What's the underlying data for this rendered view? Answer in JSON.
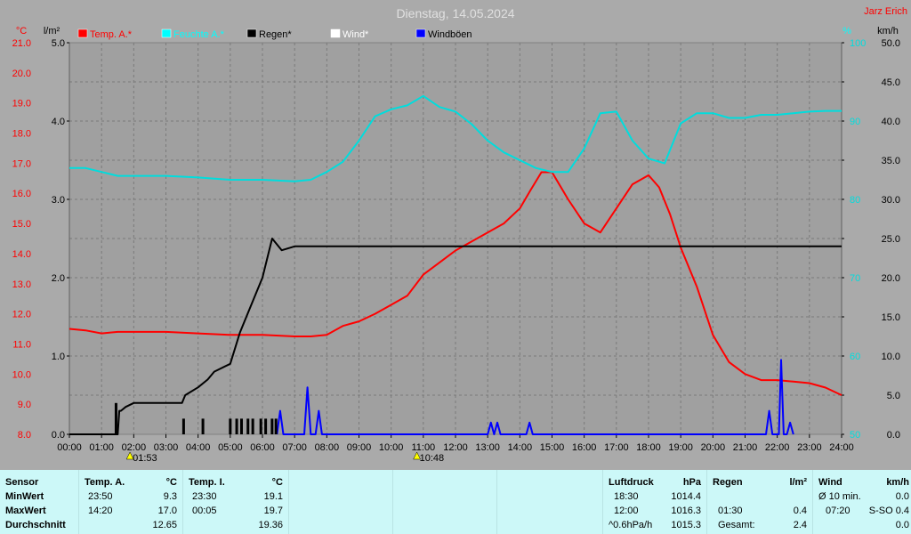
{
  "header": {
    "title": "Dienstag, 14.05.2024",
    "author": "Jarz Erich",
    "unit_temp": "°C",
    "unit_rain": "l/m²",
    "unit_humidity": "%",
    "unit_wind": "km/h"
  },
  "legend": [
    {
      "label": "Temp. A.*",
      "color": "#ff0000"
    },
    {
      "label": "Feuchte A.*",
      "color": "#00ffff"
    },
    {
      "label": "Regen*",
      "color": "#000000"
    },
    {
      "label": "Wind*",
      "color": "#ffffff"
    },
    {
      "label": "Windböen",
      "color": "#0000ff"
    }
  ],
  "chart_data": {
    "type": "line",
    "title": "Dienstag, 14.05.2024",
    "x_unit": "hours",
    "x_range": [
      0,
      24
    ],
    "x_ticks": [
      "00:00",
      "01:00",
      "02:00",
      "03:00",
      "04:00",
      "05:00",
      "06:00",
      "07:00",
      "08:00",
      "09:00",
      "10:00",
      "11:00",
      "12:00",
      "13:00",
      "14:00",
      "15:00",
      "16:00",
      "17:00",
      "18:00",
      "19:00",
      "20:00",
      "21:00",
      "22:00",
      "23:00",
      "24:00"
    ],
    "axes": {
      "temp": {
        "unit": "°C",
        "range": [
          8.0,
          21.0
        ],
        "ticks": [
          "8.0",
          "9.0",
          "10.0",
          "11.0",
          "12.0",
          "13.0",
          "14.0",
          "15.0",
          "16.0",
          "17.0",
          "18.0",
          "19.0",
          "20.0",
          "21.0"
        ],
        "color": "#ff0000"
      },
      "rain": {
        "unit": "l/m²",
        "range": [
          0.0,
          5.0
        ],
        "ticks": [
          "0.0",
          "1.0",
          "2.0",
          "3.0",
          "4.0",
          "5.0"
        ],
        "color": "#000000"
      },
      "humidity": {
        "unit": "%",
        "range": [
          50,
          100
        ],
        "ticks": [
          "50",
          "60",
          "70",
          "80",
          "90",
          "100"
        ],
        "color": "#00dddd"
      },
      "wind": {
        "unit": "km/h",
        "range": [
          0.0,
          50.0
        ],
        "ticks": [
          "0.0",
          "5.0",
          "10.0",
          "15.0",
          "20.0",
          "25.0",
          "30.0",
          "35.0",
          "40.0",
          "45.0",
          "50.0"
        ],
        "color": "#000000"
      }
    },
    "markers": [
      {
        "x": 1.883,
        "label": "01:53"
      },
      {
        "x": 10.8,
        "label": "10:48"
      }
    ],
    "series": [
      {
        "name": "Temp. A.*",
        "axis": "temp",
        "color": "#ff0000",
        "x": [
          0,
          0.5,
          1,
          1.5,
          2,
          3,
          4,
          5,
          6,
          7,
          7.5,
          8,
          8.5,
          9,
          9.5,
          10,
          10.5,
          11,
          11.5,
          12,
          12.5,
          13,
          13.5,
          14,
          14.33,
          14.67,
          15,
          15.5,
          16,
          16.5,
          17,
          17.5,
          18,
          18.33,
          18.67,
          19,
          19.5,
          20,
          20.5,
          21,
          21.5,
          22,
          22.5,
          23,
          23.5,
          24
        ],
        "values": [
          11.5,
          11.45,
          11.35,
          11.4,
          11.4,
          11.4,
          11.35,
          11.3,
          11.3,
          11.25,
          11.25,
          11.3,
          11.6,
          11.75,
          12.0,
          12.3,
          12.6,
          13.3,
          13.7,
          14.1,
          14.4,
          14.7,
          15.0,
          15.5,
          16.1,
          16.7,
          16.7,
          15.8,
          15.0,
          14.7,
          15.5,
          16.3,
          16.6,
          16.2,
          15.3,
          14.2,
          12.9,
          11.3,
          10.4,
          10.0,
          9.8,
          9.8,
          9.75,
          9.7,
          9.55,
          9.3
        ]
      },
      {
        "name": "Feuchte A.*",
        "axis": "humidity",
        "color": "#00dddd",
        "x": [
          0,
          0.5,
          1,
          1.5,
          2,
          3,
          4,
          5,
          6,
          7,
          7.5,
          8,
          8.5,
          9,
          9.5,
          10,
          10.5,
          11,
          11.5,
          12,
          12.5,
          13,
          13.5,
          14,
          14.5,
          15,
          15.5,
          16,
          16.5,
          17,
          17.5,
          18,
          18.5,
          19,
          19.5,
          20,
          20.5,
          21,
          21.5,
          22,
          22.5,
          23,
          23.5,
          24
        ],
        "values": [
          84,
          84,
          83.5,
          83,
          83,
          83,
          82.8,
          82.5,
          82.5,
          82.3,
          82.5,
          83.5,
          84.8,
          87.5,
          90.6,
          91.5,
          92,
          93.2,
          91.8,
          91.2,
          89.6,
          87.5,
          86,
          85,
          84,
          83.5,
          83.5,
          86.5,
          91,
          91.2,
          87.5,
          85.2,
          84.6,
          89.7,
          91,
          91,
          90.4,
          90.4,
          90.8,
          90.8,
          91,
          91.2,
          91.3,
          91.3
        ]
      },
      {
        "name": "Regen*",
        "axis": "rain",
        "color": "#000000",
        "x": [
          0,
          1,
          1.5,
          1.55,
          1.6,
          1.75,
          2,
          2.5,
          3,
          3.5,
          3.6,
          4,
          4.3,
          4.5,
          5,
          5.3,
          5.6,
          6,
          6.3,
          6.6,
          7,
          7.5,
          8,
          9,
          10,
          12,
          14,
          16,
          18,
          20,
          22,
          24
        ],
        "values": [
          0,
          0,
          0,
          0.3,
          0.3,
          0.35,
          0.4,
          0.4,
          0.4,
          0.4,
          0.5,
          0.6,
          0.7,
          0.8,
          0.9,
          1.3,
          1.6,
          2.0,
          2.5,
          2.35,
          2.4,
          2.4,
          2.4,
          2.4,
          2.4,
          2.4,
          2.4,
          2.4,
          2.4,
          2.4,
          2.4,
          2.4
        ]
      },
      {
        "name": "Windböen",
        "axis": "wind",
        "color": "#0000ff",
        "x": [
          6.45,
          6.55,
          6.65,
          7.3,
          7.4,
          7.5,
          7.65,
          7.75,
          7.85,
          13.0,
          13.1,
          13.2,
          13.3,
          13.4,
          13.5,
          14.2,
          14.3,
          14.4,
          21.65,
          21.75,
          21.85,
          22.05,
          22.12,
          22.2,
          22.3,
          22.4,
          22.5
        ],
        "values": [
          0,
          3,
          0,
          0,
          6,
          0,
          0,
          3,
          0,
          0,
          1.5,
          0,
          1.5,
          0,
          0,
          0,
          1.5,
          0,
          0,
          3,
          0,
          0,
          9.5,
          0,
          0,
          1.5,
          0
        ]
      },
      {
        "name": "Regen bars",
        "axis": "rain",
        "color": "#000000",
        "type": "bar",
        "x": [
          1.45,
          3.55,
          4.15,
          5.0,
          5.2,
          5.35,
          5.55,
          5.7,
          5.95,
          6.1,
          6.3,
          6.42
        ],
        "values": [
          0.4,
          0.2,
          0.2,
          0.2,
          0.2,
          0.2,
          0.2,
          0.2,
          0.2,
          0.2,
          0.2,
          0.2
        ]
      }
    ]
  },
  "table": {
    "sensor": {
      "header": "Sensor",
      "rows": [
        "MinWert",
        "MaxWert",
        "Durchschnitt"
      ]
    },
    "temp_a": {
      "header": "Temp. A.",
      "unit": "°C",
      "rows": [
        [
          "23:50",
          "9.3"
        ],
        [
          "14:20",
          "17.0"
        ],
        [
          "",
          "12.65"
        ]
      ]
    },
    "temp_i": {
      "header": "Temp. I.",
      "unit": "°C",
      "rows": [
        [
          "23:30",
          "19.1"
        ],
        [
          "00:05",
          "19.7"
        ],
        [
          "",
          "19.36"
        ]
      ]
    },
    "pressure": {
      "header": "Luftdruck",
      "unit": "hPa",
      "rows": [
        [
          "18:30",
          "1014.4"
        ],
        [
          "12:00",
          "1016.3"
        ],
        [
          "^0.6hPa/h",
          "1015.3"
        ]
      ]
    },
    "rain": {
      "header": "Regen",
      "unit": "l/m²",
      "rows": [
        [
          "",
          ""
        ],
        [
          "01:30",
          "0.4"
        ],
        [
          "Gesamt:",
          "2.4"
        ]
      ]
    },
    "wind": {
      "header": "Wind",
      "unit": "km/h",
      "rows": [
        [
          "Ø 10 min.",
          "0.0"
        ],
        [
          "07:20",
          "S-SO 0.4"
        ],
        [
          "",
          "0.0"
        ]
      ]
    }
  }
}
